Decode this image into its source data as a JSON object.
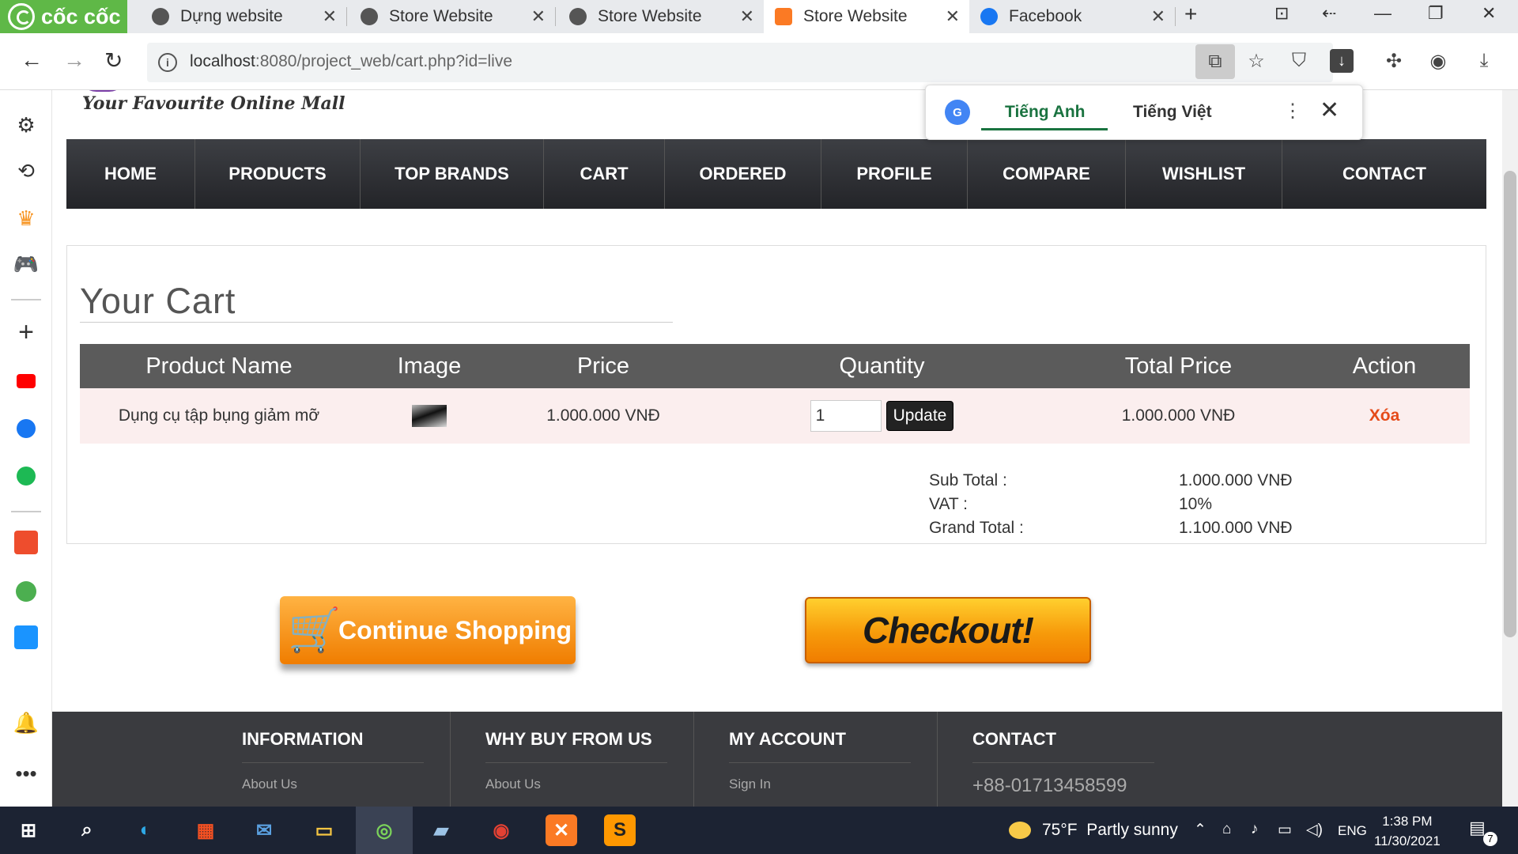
{
  "browser": {
    "brand": "cốc cốc",
    "tabs": [
      {
        "title": "Dựng website",
        "icon": "globe-icon"
      },
      {
        "title": "Store Website",
        "icon": "globe-icon"
      },
      {
        "title": "Store Website",
        "icon": "globe-icon"
      },
      {
        "title": "Store Website",
        "icon": "xampp-icon",
        "active": true
      },
      {
        "title": "Facebook",
        "icon": "facebook-icon"
      }
    ],
    "new_tab": "+",
    "url_host": "localhost",
    "url_rest": ":8080/project_web/cart.php?id=live"
  },
  "translate": {
    "lang_from": "Tiếng Anh",
    "lang_to": "Tiếng Việt"
  },
  "site": {
    "tagline": "Your Favourite Online Mall",
    "nav": [
      "HOME",
      "PRODUCTS",
      "TOP BRANDS",
      "CART",
      "ORDERED",
      "PROFILE",
      "COMPARE",
      "WISHLIST",
      "CONTACT"
    ]
  },
  "cart": {
    "title": "Your Cart",
    "headers": {
      "name": "Product Name",
      "image": "Image",
      "price": "Price",
      "quantity": "Quantity",
      "total": "Total Price",
      "action": "Action"
    },
    "rows": [
      {
        "name": "Dụng cụ tập bụng giảm mỡ",
        "price": "1.000.000 VNĐ",
        "quantity": "1",
        "update": "Update",
        "total": "1.000.000 VNĐ",
        "action": "Xóa"
      }
    ],
    "summary": {
      "subtotal_label": "Sub Total :",
      "subtotal": "1.000.000 VNĐ",
      "vat_label": "VAT :",
      "vat": "10%",
      "grand_label": "Grand Total :",
      "grand": "1.100.000 VNĐ"
    },
    "continue_label": "Continue Shopping",
    "checkout_label": "Checkout!"
  },
  "footer": {
    "cols": [
      {
        "heading": "INFORMATION",
        "first_link": "About Us"
      },
      {
        "heading": "WHY BUY FROM US",
        "first_link": "About Us"
      },
      {
        "heading": "MY ACCOUNT",
        "first_link": "Sign In"
      },
      {
        "heading": "CONTACT",
        "first_link": "+88-01713458599"
      }
    ]
  },
  "taskbar": {
    "weather_temp": "75°F",
    "weather_text": "Partly sunny",
    "lang": "ENG",
    "time": "1:38 PM",
    "date": "11/30/2021",
    "notifications": "7"
  },
  "colors": {
    "nav_bg": "#2e2f33",
    "table_header": "#5b5b5b",
    "row_bg": "#fbeeee",
    "delete": "#e54b1a",
    "accent_orange": "#f79a0a",
    "footer_bg": "#3a3b3f",
    "brand_green": "#5fb847"
  }
}
